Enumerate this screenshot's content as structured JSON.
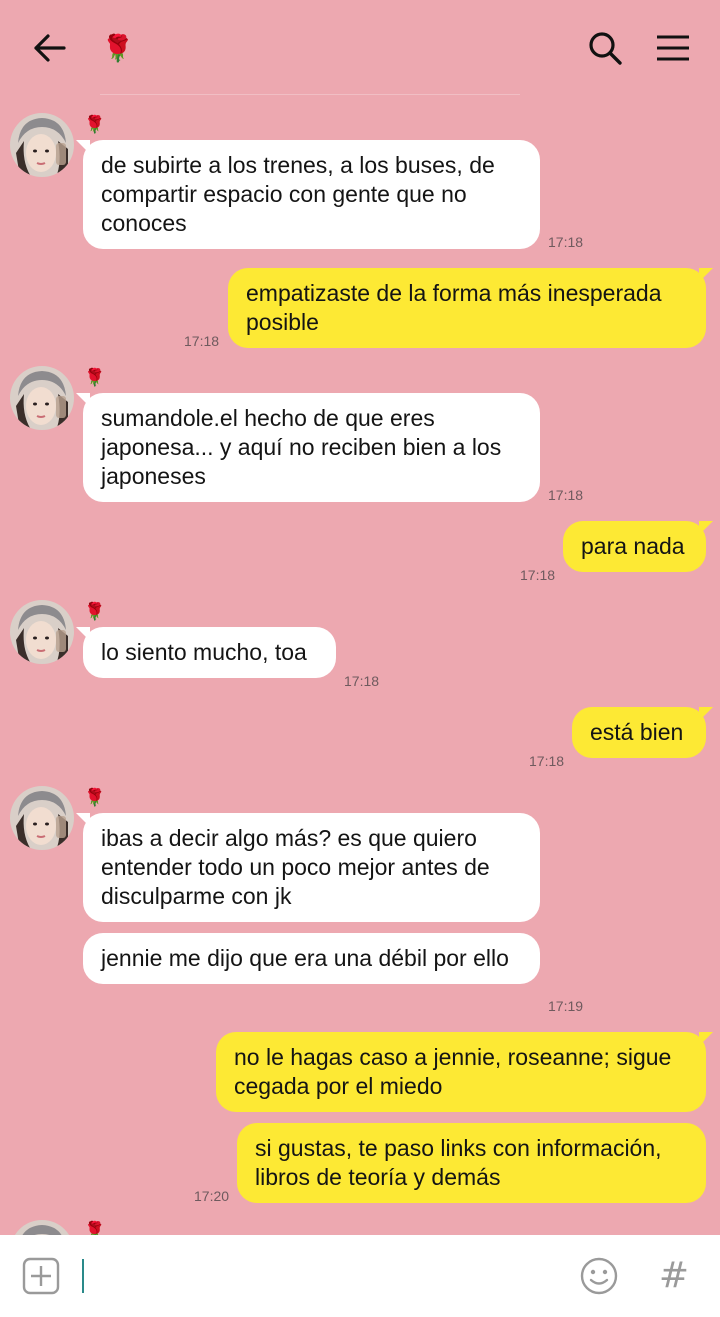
{
  "header": {
    "title_icon": "rose-emoji",
    "title_emoji": "🌹"
  },
  "sender": {
    "emoji": "🌹"
  },
  "messages": [
    {
      "dir": "in",
      "text": "de subirte a los trenes, a los buses, de compartir espacio con gente que no conoces",
      "time": "17:18"
    },
    {
      "dir": "out",
      "text": "empatizaste de la forma más inesperada posible",
      "time": "17:18"
    },
    {
      "dir": "in",
      "text": "sumandole.el hecho de que eres japonesa... y aquí no reciben bien a los japoneses",
      "time": "17:18"
    },
    {
      "dir": "out",
      "text": "para nada",
      "time": "17:18"
    },
    {
      "dir": "in",
      "text": "lo siento mucho, toa",
      "time": "17:18"
    },
    {
      "dir": "out",
      "text": "está bien",
      "time": "17:18"
    },
    {
      "dir": "in",
      "text": "ibas a decir algo más? es que quiero entender todo un poco mejor antes de disculparme con jk",
      "time": ""
    },
    {
      "dir": "in",
      "text": "jennie me dijo que era una débil por ello",
      "time": "17:19"
    },
    {
      "dir": "out",
      "text": "no le hagas caso a jennie, roseanne; sigue cegada por el miedo",
      "time": ""
    },
    {
      "dir": "out",
      "text": "si gustas, te paso links con información, libros de teoría y demás",
      "time": "17:20"
    }
  ],
  "colors": {
    "background": "#EDA8B0",
    "incoming_bubble": "#FFFFFF",
    "outgoing_bubble": "#FDE934"
  }
}
